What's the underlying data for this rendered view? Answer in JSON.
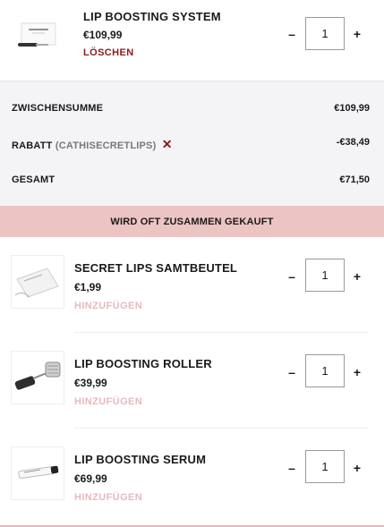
{
  "cart_item": {
    "title": "LIP BOOSTING SYSTEM",
    "price": "€109,99",
    "remove_label": "LÖSCHEN",
    "quantity": "1",
    "minus": "–",
    "plus": "+"
  },
  "summary": {
    "subtotal_label": "ZWISCHENSUMME",
    "subtotal_value": "€109,99",
    "discount_label": "RABATT",
    "discount_code": "(CATHISECRETLIPS)",
    "discount_remove": "✕",
    "discount_value": "-€38,49",
    "total_label": "GESAMT",
    "total_value": "€71,50"
  },
  "banner": {
    "label": "WIRD OFT ZUSAMMEN GEKAUFT"
  },
  "recommendations": [
    {
      "title": "SECRET LIPS SAMTBEUTEL",
      "price": "€1,99",
      "add_label": "HINZUFÜGEN",
      "quantity": "1",
      "minus": "–",
      "plus": "+"
    },
    {
      "title": "LIP BOOSTING ROLLER",
      "price": "€39,99",
      "add_label": "HINZUFÜGEN",
      "quantity": "1",
      "minus": "–",
      "plus": "+"
    },
    {
      "title": "LIP BOOSTING SERUM",
      "price": "€69,99",
      "add_label": "HINZUFÜGEN",
      "quantity": "1",
      "minus": "–",
      "plus": "+"
    }
  ],
  "colors": {
    "accent_dark_red": "#8b1a1a",
    "banner_pink": "#ecc4c4",
    "add_pink": "#e9b8bf",
    "summary_bg": "#f4f4f6"
  },
  "icons": [
    "product-box-icon",
    "velvet-pouch-icon",
    "derma-roller-icon",
    "serum-tube-icon"
  ]
}
